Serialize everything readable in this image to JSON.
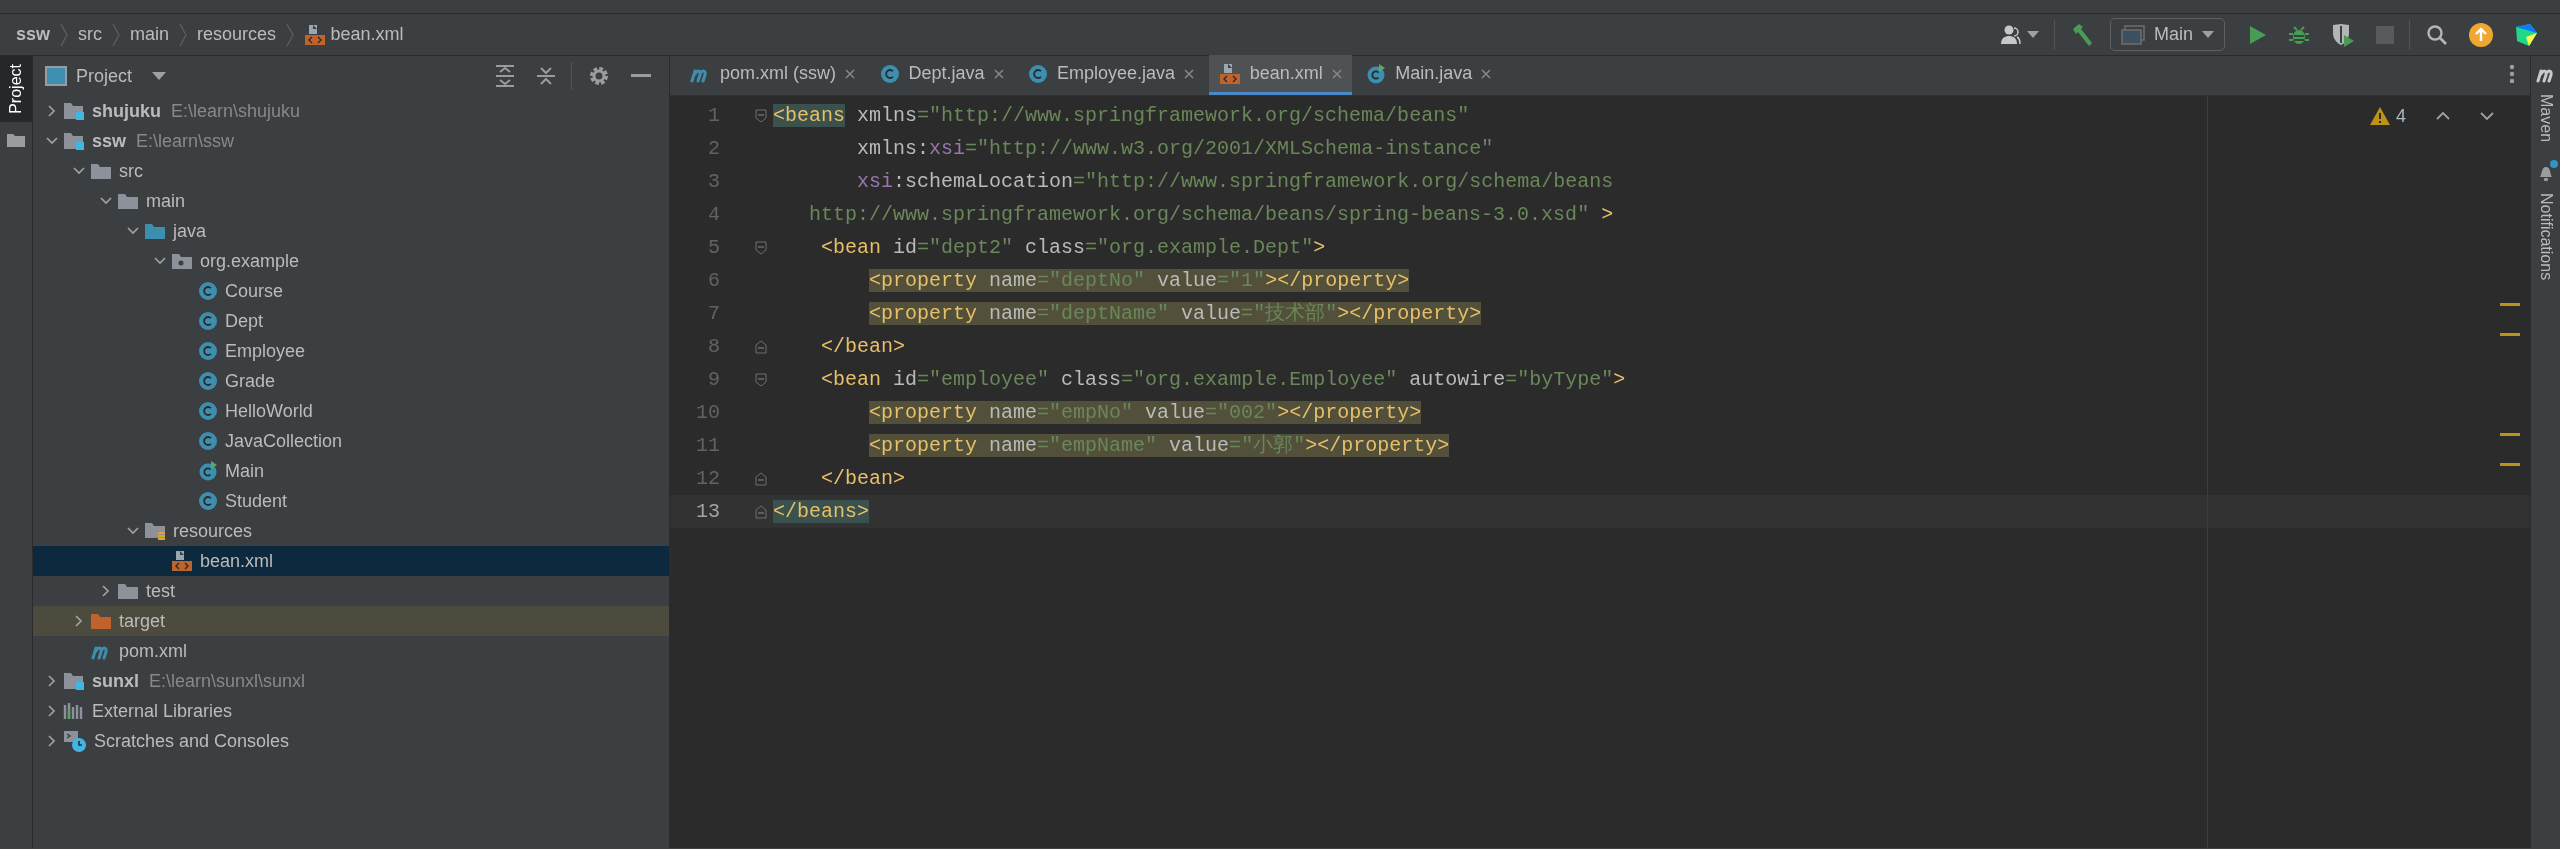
{
  "breadcrumbs": [
    {
      "label": "ssw",
      "kind": "module"
    },
    {
      "label": "src",
      "kind": "folder"
    },
    {
      "label": "main",
      "kind": "folder"
    },
    {
      "label": "resources",
      "kind": "folder"
    },
    {
      "label": "bean.xml",
      "kind": "xml-file"
    }
  ],
  "toolbar": {
    "run_config": "Main",
    "stop": {
      "disabled": true
    },
    "update_available": true
  },
  "left_stripe": {
    "tabs": [
      {
        "label": "Project",
        "selected": true
      }
    ]
  },
  "project_panel": {
    "title": "Project",
    "tree": [
      {
        "label": "shujuku",
        "path": "E:\\learn\\shujuku",
        "kind": "module",
        "expanded": false,
        "selected": false
      },
      {
        "label": "ssw",
        "path": "E:\\learn\\ssw",
        "kind": "module",
        "expanded": true,
        "selected": false,
        "children": [
          {
            "label": "src",
            "kind": "folder",
            "expanded": true,
            "selected": false,
            "children": [
              {
                "label": "main",
                "kind": "folder",
                "expanded": true,
                "selected": false,
                "children": [
                  {
                    "label": "java",
                    "kind": "source-folder",
                    "expanded": true,
                    "selected": false,
                    "children": [
                      {
                        "label": "org.example",
                        "kind": "package",
                        "expanded": true,
                        "selected": false,
                        "children": [
                          {
                            "label": "Course",
                            "kind": "class",
                            "selected": false
                          },
                          {
                            "label": "Dept",
                            "kind": "class",
                            "selected": false
                          },
                          {
                            "label": "Employee",
                            "kind": "class",
                            "selected": false
                          },
                          {
                            "label": "Grade",
                            "kind": "class",
                            "selected": false
                          },
                          {
                            "label": "HelloWorld",
                            "kind": "class",
                            "selected": false
                          },
                          {
                            "label": "JavaCollection",
                            "kind": "class",
                            "selected": false
                          },
                          {
                            "label": "Main",
                            "kind": "main-class",
                            "selected": false
                          },
                          {
                            "label": "Student",
                            "kind": "class",
                            "selected": false
                          }
                        ]
                      }
                    ]
                  },
                  {
                    "label": "resources",
                    "kind": "resources-folder",
                    "expanded": true,
                    "selected": false,
                    "children": [
                      {
                        "label": "bean.xml",
                        "kind": "xml-file",
                        "selected": true
                      }
                    ]
                  }
                ]
              },
              {
                "label": "test",
                "kind": "folder",
                "expanded": false,
                "selected": false
              }
            ]
          },
          {
            "label": "target",
            "kind": "excluded-folder",
            "expanded": false,
            "selected": false
          },
          {
            "label": "pom.xml",
            "kind": "maven-file",
            "selected": false
          }
        ]
      },
      {
        "label": "sunxl",
        "path": "E:\\learn\\sunxl\\sunxl",
        "kind": "module",
        "expanded": false,
        "selected": false
      },
      {
        "label": "External Libraries",
        "kind": "libraries",
        "expanded": false,
        "selected": false
      },
      {
        "label": "Scratches and Consoles",
        "kind": "scratches",
        "expanded": false,
        "selected": false
      }
    ]
  },
  "editor": {
    "tabs": [
      {
        "label": "pom.xml (ssw)",
        "kind": "maven-file",
        "selected": false
      },
      {
        "label": "Dept.java",
        "kind": "class",
        "selected": false
      },
      {
        "label": "Employee.java",
        "kind": "class",
        "selected": false
      },
      {
        "label": "bean.xml",
        "kind": "xml-file",
        "selected": true
      },
      {
        "label": "Main.java",
        "kind": "main-class",
        "selected": false
      }
    ],
    "warnings": "4",
    "lines": [
      {
        "number": "1",
        "kind": "root",
        "fold_open": true,
        "fold_close": false,
        "highlighted": false,
        "current": false,
        "tokens": [
          {
            "kind": "tag-match",
            "text": "<beans"
          },
          {
            "kind": "attr",
            "text": " xmlns"
          },
          {
            "kind": "eq",
            "text": "="
          },
          {
            "kind": "str",
            "text": "\"http://www.springframework.org/schema/beans\""
          }
        ]
      },
      {
        "number": "2",
        "kind": "attribute",
        "fold_open": false,
        "fold_close": false,
        "highlighted": false,
        "current": false,
        "tokens": [
          {
            "kind": "attr",
            "text": "xmlns"
          },
          {
            "kind": "colon",
            "text": ":"
          },
          {
            "kind": "ns",
            "text": "xsi"
          },
          {
            "kind": "eq",
            "text": "="
          },
          {
            "kind": "str",
            "text": "\"http://www.w3.org/2001/XMLSchema-instance\""
          }
        ]
      },
      {
        "number": "3",
        "kind": "attribute",
        "fold_open": false,
        "fold_close": false,
        "highlighted": false,
        "current": false,
        "tokens": [
          {
            "kind": "ns",
            "text": "xsi"
          },
          {
            "kind": "colon",
            "text": ":"
          },
          {
            "kind": "attr",
            "text": "schemaLocation"
          },
          {
            "kind": "eq",
            "text": "="
          },
          {
            "kind": "str",
            "text": "\"http://www.springframework.org/schema/beans"
          }
        ]
      },
      {
        "number": "4",
        "kind": "continuation",
        "fold_open": false,
        "fold_close": false,
        "highlighted": false,
        "current": false,
        "tokens": [
          {
            "kind": "str",
            "text": "http://www.springframework.org/schema/beans/spring-beans-3.0.xsd\""
          },
          {
            "kind": "tag",
            "text": " >"
          }
        ]
      },
      {
        "number": "5",
        "kind": "child",
        "fold_open": true,
        "fold_close": false,
        "highlighted": false,
        "current": false,
        "tokens": [
          {
            "kind": "tag",
            "text": "<bean"
          },
          {
            "kind": "attr",
            "text": " id"
          },
          {
            "kind": "eq",
            "text": "="
          },
          {
            "kind": "str",
            "text": "\"dept2\""
          },
          {
            "kind": "attr",
            "text": " class"
          },
          {
            "kind": "eq",
            "text": "="
          },
          {
            "kind": "str",
            "text": "\"org.example.Dept\""
          },
          {
            "kind": "tag",
            "text": ">"
          }
        ]
      },
      {
        "number": "6",
        "kind": "grandchild",
        "fold_open": false,
        "fold_close": false,
        "highlighted": true,
        "current": false,
        "tokens": [
          {
            "kind": "tag",
            "text": "<property"
          },
          {
            "kind": "attr",
            "text": " name"
          },
          {
            "kind": "eq",
            "text": "="
          },
          {
            "kind": "str",
            "text": "\"deptNo\""
          },
          {
            "kind": "attr",
            "text": " value"
          },
          {
            "kind": "eq",
            "text": "="
          },
          {
            "kind": "str",
            "text": "\"1\""
          },
          {
            "kind": "tag",
            "text": "></property>"
          }
        ]
      },
      {
        "number": "7",
        "kind": "grandchild",
        "fold_open": false,
        "fold_close": false,
        "highlighted": true,
        "current": false,
        "tokens": [
          {
            "kind": "tag",
            "text": "<property"
          },
          {
            "kind": "attr",
            "text": " name"
          },
          {
            "kind": "eq",
            "text": "="
          },
          {
            "kind": "str",
            "text": "\"deptName\""
          },
          {
            "kind": "attr",
            "text": " value"
          },
          {
            "kind": "eq",
            "text": "="
          },
          {
            "kind": "str",
            "text": "\"技术部\""
          },
          {
            "kind": "tag",
            "text": "></property>"
          }
        ]
      },
      {
        "number": "8",
        "kind": "child",
        "fold_open": false,
        "fold_close": true,
        "highlighted": false,
        "current": false,
        "tokens": [
          {
            "kind": "tag",
            "text": "</bean>"
          }
        ]
      },
      {
        "number": "9",
        "kind": "child",
        "fold_open": true,
        "fold_close": false,
        "highlighted": false,
        "current": false,
        "tokens": [
          {
            "kind": "tag",
            "text": "<bean"
          },
          {
            "kind": "attr",
            "text": " id"
          },
          {
            "kind": "eq",
            "text": "="
          },
          {
            "kind": "str",
            "text": "\"employee\""
          },
          {
            "kind": "attr",
            "text": " class"
          },
          {
            "kind": "eq",
            "text": "="
          },
          {
            "kind": "str",
            "text": "\"org.example.Employee\""
          },
          {
            "kind": "attr",
            "text": " autowire"
          },
          {
            "kind": "eq",
            "text": "="
          },
          {
            "kind": "str",
            "text": "\"byType\""
          },
          {
            "kind": "tag",
            "text": ">"
          }
        ]
      },
      {
        "number": "10",
        "kind": "grandchild",
        "fold_open": false,
        "fold_close": false,
        "highlighted": true,
        "current": false,
        "tokens": [
          {
            "kind": "tag",
            "text": "<property"
          },
          {
            "kind": "attr",
            "text": " name"
          },
          {
            "kind": "eq",
            "text": "="
          },
          {
            "kind": "str",
            "text": "\"empNo\""
          },
          {
            "kind": "attr",
            "text": " value"
          },
          {
            "kind": "eq",
            "text": "="
          },
          {
            "kind": "str",
            "text": "\"002\""
          },
          {
            "kind": "tag",
            "text": "></property>"
          }
        ]
      },
      {
        "number": "11",
        "kind": "grandchild",
        "fold_open": false,
        "fold_close": false,
        "highlighted": true,
        "current": false,
        "tokens": [
          {
            "kind": "tag",
            "text": "<property"
          },
          {
            "kind": "attr",
            "text": " name"
          },
          {
            "kind": "eq",
            "text": "="
          },
          {
            "kind": "str",
            "text": "\"empName\""
          },
          {
            "kind": "attr",
            "text": " value"
          },
          {
            "kind": "eq",
            "text": "="
          },
          {
            "kind": "str",
            "text": "\"小郭\""
          },
          {
            "kind": "tag",
            "text": "></property>"
          }
        ]
      },
      {
        "number": "12",
        "kind": "child",
        "fold_open": false,
        "fold_close": true,
        "highlighted": false,
        "current": false,
        "tokens": [
          {
            "kind": "tag",
            "text": "</bean>"
          }
        ]
      },
      {
        "number": "13",
        "kind": "root",
        "fold_open": false,
        "fold_close": true,
        "highlighted": false,
        "current": true,
        "tokens": [
          {
            "kind": "tag-match",
            "text": "</beans>"
          }
        ]
      }
    ]
  },
  "right_stripe": {
    "tabs": [
      {
        "label": "Maven",
        "kind": "maven",
        "unread": false
      },
      {
        "label": "Notifications",
        "kind": "notifications",
        "unread": true
      }
    ]
  }
}
